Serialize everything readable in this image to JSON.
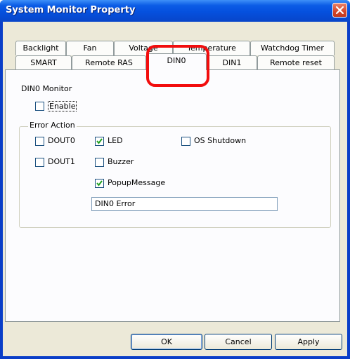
{
  "window": {
    "title": "System Monitor Property"
  },
  "tabs": {
    "row1": [
      "Backlight",
      "Fan",
      "Voltage",
      "Temperature",
      "Watchdog Timer"
    ],
    "row2": [
      "SMART",
      "Remote RAS",
      "DIN0",
      "DIN1",
      "Remote reset"
    ],
    "active": "DIN0"
  },
  "monitor": {
    "heading": "DIN0 Monitor",
    "enable_label": "Enable",
    "enable_checked": false
  },
  "error_action": {
    "caption": "Error Action",
    "dout0": {
      "label": "DOUT0",
      "checked": false
    },
    "led": {
      "label": "LED",
      "checked": true
    },
    "os_shutdown": {
      "label": "OS Shutdown",
      "checked": false
    },
    "dout1": {
      "label": "DOUT1",
      "checked": false
    },
    "buzzer": {
      "label": "Buzzer",
      "checked": false
    },
    "popup": {
      "label": "PopupMessage",
      "checked": true
    },
    "message_value": "DIN0 Error"
  },
  "buttons": {
    "ok": "OK",
    "cancel": "Cancel",
    "apply": "Apply"
  },
  "colors": {
    "title_bar": "#0a5ae6",
    "highlight": "#f20d0d",
    "face": "#ece9d8"
  }
}
